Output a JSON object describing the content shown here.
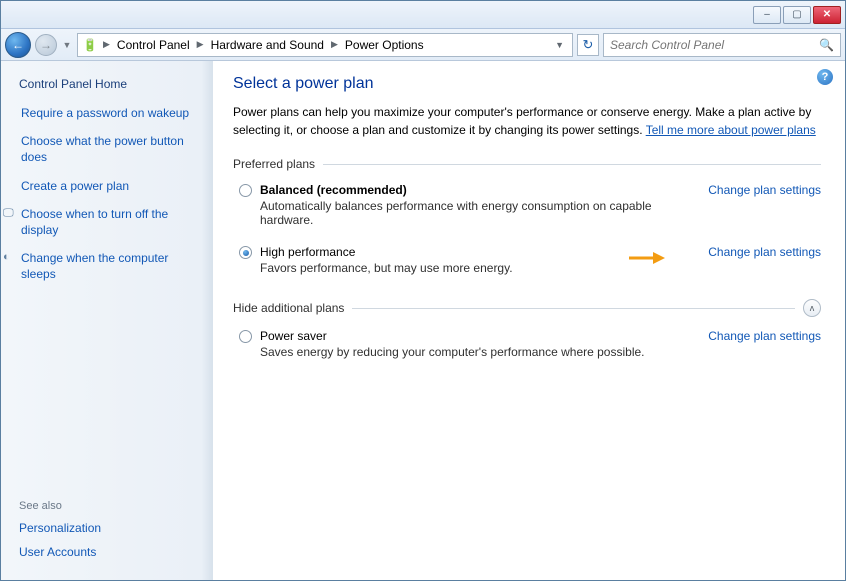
{
  "titlebar": {
    "min": "–",
    "max": "▢",
    "close": "✕"
  },
  "nav": {
    "back": "←",
    "fwd": "→"
  },
  "breadcrumb": {
    "root": "Control Panel",
    "mid": "Hardware and Sound",
    "leaf": "Power Options"
  },
  "search": {
    "placeholder": "Search Control Panel"
  },
  "sidebar": {
    "home": "Control Panel Home",
    "links": [
      {
        "label": "Require a password on wakeup",
        "icon": ""
      },
      {
        "label": "Choose what the power button does",
        "icon": ""
      },
      {
        "label": "Create a power plan",
        "icon": ""
      },
      {
        "label": "Choose when to turn off the display",
        "icon": "🖵"
      },
      {
        "label": "Change when the computer sleeps",
        "icon": "◐"
      }
    ],
    "see_also_hdr": "See also",
    "see_also": [
      {
        "label": "Personalization"
      },
      {
        "label": "User Accounts"
      }
    ]
  },
  "main": {
    "title": "Select a power plan",
    "intro_a": "Power plans can help you maximize your computer's performance or conserve energy. Make a plan active by selecting it, or choose a plan and customize it by changing its power settings. ",
    "intro_link": "Tell me more about power plans",
    "preferred_hdr": "Preferred plans",
    "hide_hdr": "Hide additional plans",
    "change_link": "Change plan settings",
    "plans": {
      "balanced": {
        "name": "Balanced (recommended)",
        "desc": "Automatically balances performance with energy consumption on capable hardware."
      },
      "high": {
        "name": "High performance",
        "desc": "Favors performance, but may use more energy."
      },
      "saver": {
        "name": "Power saver",
        "desc": "Saves energy by reducing your computer's performance where possible."
      }
    }
  }
}
